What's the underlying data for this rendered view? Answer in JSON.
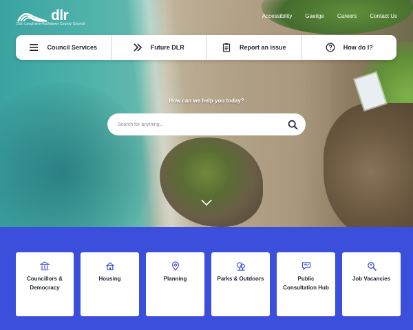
{
  "brand": {
    "name": "dlr",
    "subtitle": "Dún Laoghaire-Rathdown County Council"
  },
  "top_links": [
    "Accessibility",
    "Gaeilge",
    "Careers",
    "Contact Us"
  ],
  "nav": [
    {
      "label": "Council Services",
      "icon": "menu-icon"
    },
    {
      "label": "Future DLR",
      "icon": "double-chevron-right-icon"
    },
    {
      "label": "Report an issue",
      "icon": "clipboard-icon"
    },
    {
      "label": "How do I?",
      "icon": "question-circle-icon"
    }
  ],
  "search": {
    "prompt": "How can we help you today?",
    "placeholder": "Search for anything..."
  },
  "tiles": [
    {
      "label": "Councillors & Democracy",
      "icon": "building-columns-icon"
    },
    {
      "label": "Housing",
      "icon": "house-icon"
    },
    {
      "label": "Planning",
      "icon": "map-pin-icon"
    },
    {
      "label": "Parks & Outdoors",
      "icon": "tree-icon"
    },
    {
      "label": "Public Consultation Hub",
      "icon": "chat-icon"
    },
    {
      "label": "Job Vacancies",
      "icon": "magnifier-icon"
    }
  ],
  "colors": {
    "band": "#3c4fdc",
    "accent": "#3c4fdc",
    "nav_text": "#1f2330"
  }
}
